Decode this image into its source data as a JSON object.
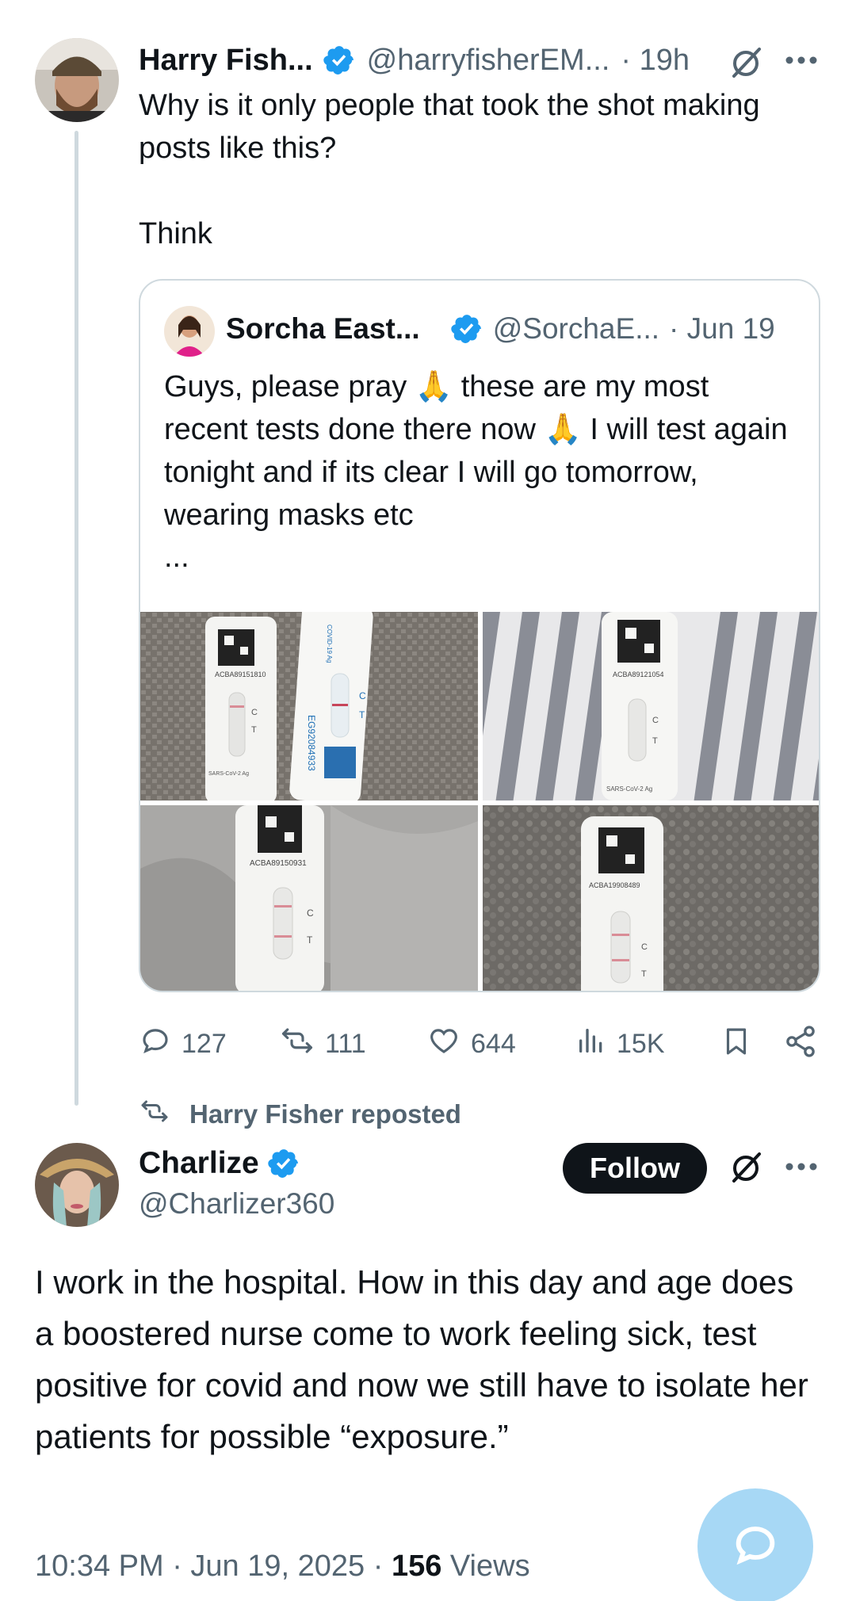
{
  "parent_tweet": {
    "author_name": "Harry Fish...",
    "author_handle": "@harryfisherEM...",
    "time": "· 19h",
    "text": "Why is it only people that took the shot making posts like this?\n\nThink"
  },
  "quoted_tweet": {
    "author_name": "Sorcha East...",
    "author_handle": "@SorchaE...",
    "date": "· Jun 19",
    "text": "Guys, please pray 🙏 these are my most recent tests done there now 🙏 I will test again tonight and if its clear I will go tomorrow, wearing masks etc",
    "ellipsis": "...",
    "test_labels": [
      "ACBA89151810",
      "EG92084933",
      "ACBA89121054",
      "ACBA89150931",
      "ACBA19908489"
    ],
    "test_ct": {
      "c": "C",
      "t": "T"
    },
    "covid_label": "COVID-19 Ag",
    "sars_label": "SARS-CoV-2 Ag"
  },
  "actions": {
    "replies": "127",
    "reposts": "111",
    "likes": "644",
    "views": "15K"
  },
  "repost_banner": "Harry Fisher reposted",
  "main_tweet": {
    "author_name": "Charlize",
    "author_handle": "@Charlizer360",
    "follow_label": "Follow",
    "text": "I work in the hospital. How in this day and age does a boostered nurse come to work feeling sick, test positive for covid and now we still have to isolate her patients for possible “exposure.”",
    "time": "10:34 PM · Jun 19, 2025 · ",
    "views_count": "156",
    "views_label": " Views"
  },
  "colors": {
    "verified": "#1d9bf0",
    "muted": "#536471",
    "border": "#cfd9de",
    "fab": "#a7d8f5"
  },
  "icons": [
    "verified-badge-icon",
    "grok-icon",
    "more-icon",
    "reply-icon",
    "repost-icon",
    "like-icon",
    "views-icon",
    "bookmark-icon",
    "share-icon",
    "compose-reply-icon"
  ]
}
